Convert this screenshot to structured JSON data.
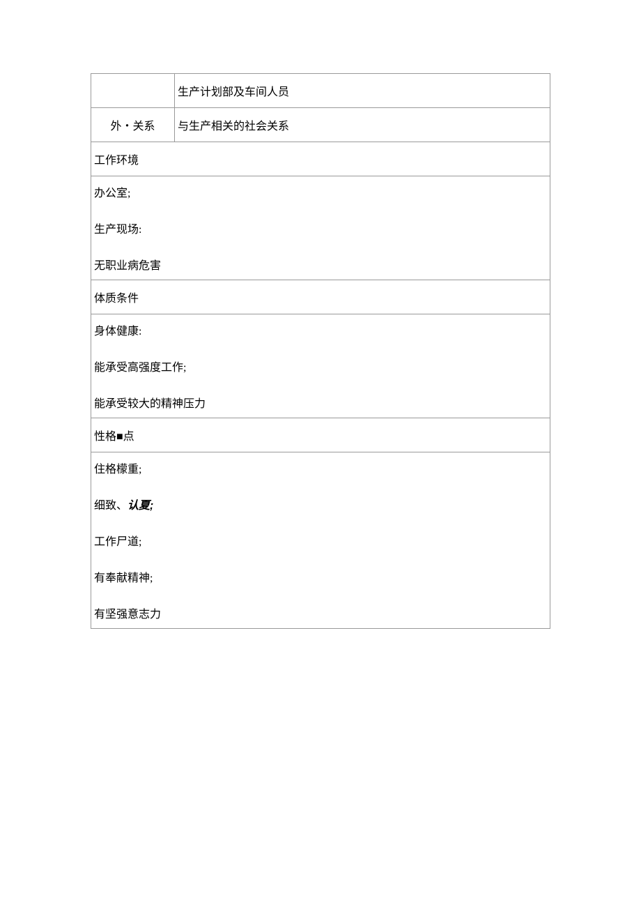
{
  "row1": {
    "left": "",
    "right": "生产计划部及车间人员"
  },
  "row2": {
    "left": "外・关系",
    "right": "与生产相关的社会关系"
  },
  "section1": {
    "header": "工作环境",
    "line1": "办公室;",
    "line2": "生产现场:",
    "line3": "无职业病危害"
  },
  "section2": {
    "header": "体质条件",
    "line1": "身体健康:",
    "line2": "能承受高强度工作;",
    "line3": "能承受较大的精神压力"
  },
  "section3": {
    "header": "性格■点",
    "line1": "住格檬重;",
    "line2a": "细致、",
    "line2b": "认夏;",
    "line3": "工作尸道;",
    "line4": "有奉献精神;",
    "line5": "有坚强意志力"
  }
}
